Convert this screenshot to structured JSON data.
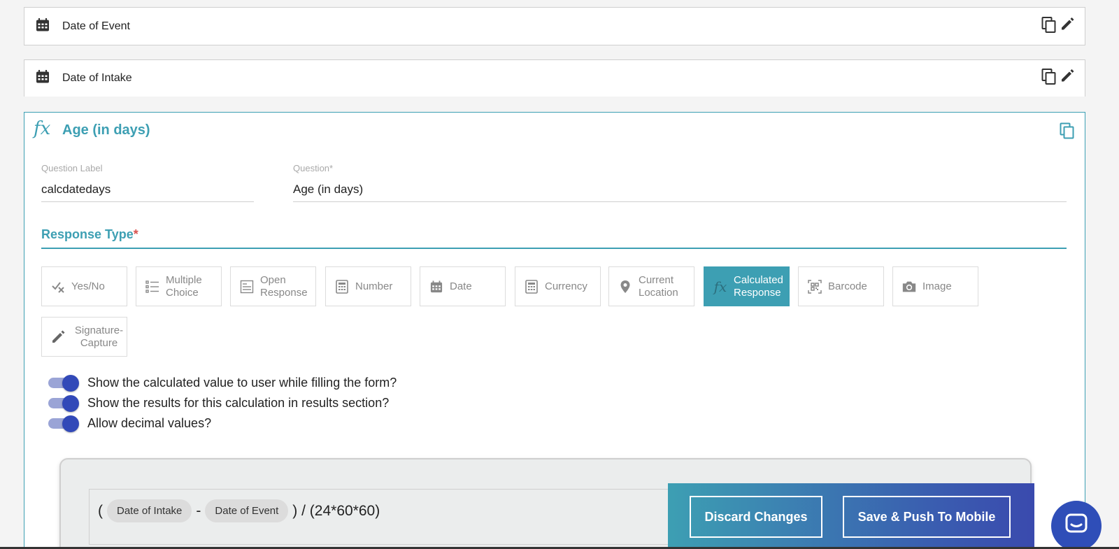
{
  "questions": [
    {
      "title": "Date of Event",
      "icon": "calendar-icon"
    },
    {
      "title": "Date of Intake",
      "icon": "calendar-icon"
    }
  ],
  "active_question": {
    "fx_symbol": "fx",
    "title": "Age (in days)",
    "question_label_caption": "Question Label",
    "question_label_value": "calcdatedays",
    "question_caption": "Question*",
    "question_value": "Age (in days)"
  },
  "response_type": {
    "label": "Response Type",
    "required_mark": "*",
    "selected": "Calculated Response",
    "options": [
      {
        "label": "Yes/No",
        "icon": "yes-no-icon"
      },
      {
        "label": "Multiple Choice",
        "icon": "list-icon"
      },
      {
        "label": "Open Response",
        "icon": "text-block-icon"
      },
      {
        "label": "Number",
        "icon": "calculator-icon"
      },
      {
        "label": "Date",
        "icon": "calendar-icon"
      },
      {
        "label": "Currency",
        "icon": "calculator-icon"
      },
      {
        "label": "Current Location",
        "icon": "location-pin-icon"
      },
      {
        "label": "Calculated Response",
        "icon": "fx-icon"
      },
      {
        "label": "Barcode",
        "icon": "qr-code-icon"
      },
      {
        "label": "Image",
        "icon": "camera-icon"
      },
      {
        "label": "Signature-Capture",
        "icon": "pencil-icon"
      }
    ]
  },
  "toggles": [
    {
      "label": "Show the calculated value to user while filling the form?",
      "on": true
    },
    {
      "label": "Show the results for this calculation in results section?",
      "on": true
    },
    {
      "label": "Allow decimal values?",
      "on": true
    }
  ],
  "formula": {
    "open_paren": "(",
    "operand_a": "Date of Intake",
    "operator": "-",
    "operand_b": "Date of Event",
    "tail": ") / (24*60*60)"
  },
  "actions": {
    "discard_label": "Discard Changes",
    "save_label": "Save & Push To Mobile"
  },
  "colors": {
    "accent": "#3d9fb3",
    "toggle": "#3249b8",
    "chat": "#2f4eb8"
  }
}
